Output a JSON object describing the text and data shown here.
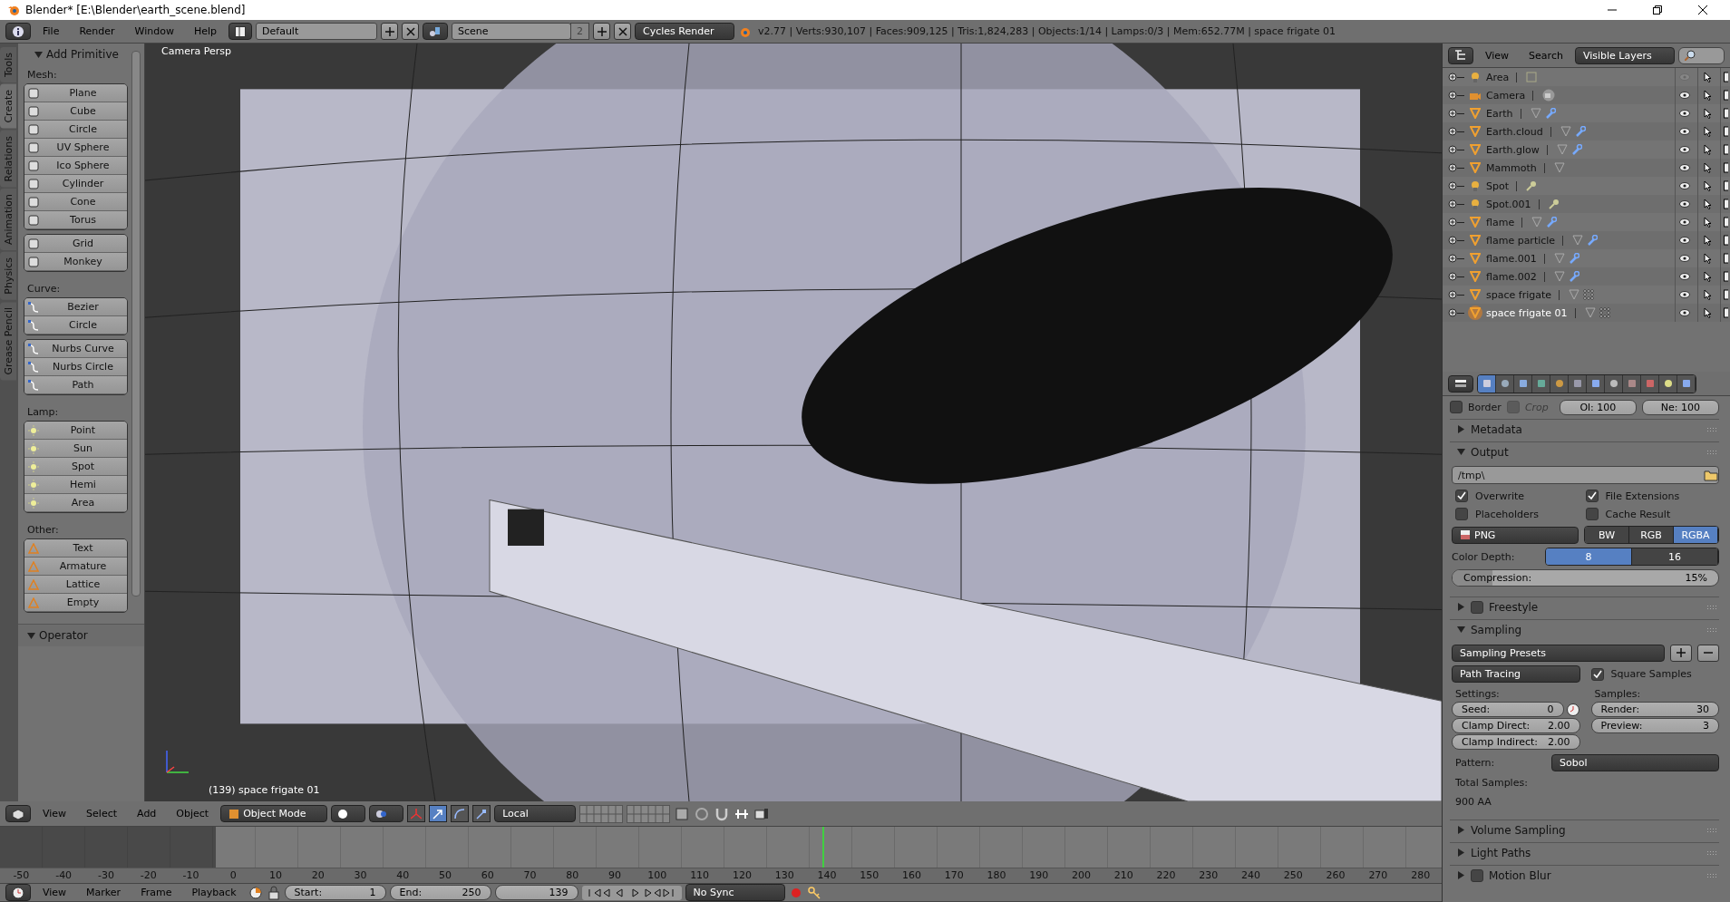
{
  "window": {
    "title": "Blender* [E:\\Blender\\earth_scene.blend]"
  },
  "top_header": {
    "menus": [
      "File",
      "Render",
      "Window",
      "Help"
    ],
    "layout": "Default",
    "scene": "Scene",
    "scene_users": "2",
    "engine": "Cycles Render",
    "stats": "v2.77 | Verts:930,107 | Faces:909,125 | Tris:1,824,283 | Objects:1/14 | Lamps:0/3 | Mem:652.77M | space frigate 01"
  },
  "tool_tabs": [
    {
      "label": "Tools",
      "selected": false
    },
    {
      "label": "Create",
      "selected": true
    },
    {
      "label": "Relations",
      "selected": false
    },
    {
      "label": "Animation",
      "selected": false
    },
    {
      "label": "Physics",
      "selected": false
    },
    {
      "label": "Grease Pencil",
      "selected": false
    }
  ],
  "add_primitive": {
    "title": "Add Primitive",
    "expanded": true,
    "groups": [
      {
        "label": "Mesh:",
        "kind": "mesh",
        "blocks": [
          [
            "Plane",
            "Cube",
            "Circle",
            "UV Sphere",
            "Ico Sphere",
            "Cylinder",
            "Cone",
            "Torus"
          ],
          [
            "Grid",
            "Monkey"
          ]
        ]
      },
      {
        "label": "Curve:",
        "kind": "curve",
        "blocks": [
          [
            "Bezier",
            "Circle"
          ],
          [
            "Nurbs Curve",
            "Nurbs Circle",
            "Path"
          ]
        ]
      },
      {
        "label": "Lamp:",
        "kind": "lamp",
        "blocks": [
          [
            "Point",
            "Sun",
            "Spot",
            "Hemi",
            "Area"
          ]
        ]
      },
      {
        "label": "Other:",
        "kind": "other",
        "blocks": [
          [
            "Text",
            "Armature",
            "Lattice",
            "Empty"
          ]
        ]
      }
    ]
  },
  "operator_panel": {
    "title": "Operator",
    "expanded": true
  },
  "viewport": {
    "view_name": "Camera Persp",
    "object_label": "(139) space frigate 01"
  },
  "view3d_header": {
    "menus": [
      "View",
      "Select",
      "Add",
      "Object"
    ],
    "mode": "Object Mode",
    "orientation": "Local",
    "manipulators": [
      {
        "selected": false
      },
      {
        "selected": true
      },
      {
        "selected": false
      },
      {
        "selected": false
      }
    ]
  },
  "timeline": {
    "ticks": [
      "-50",
      "-40",
      "-30",
      "-20",
      "-10",
      "0",
      "10",
      "20",
      "30",
      "40",
      "50",
      "60",
      "70",
      "80",
      "90",
      "100",
      "110",
      "120",
      "130",
      "140",
      "150",
      "160",
      "170",
      "180",
      "190",
      "200",
      "210",
      "220",
      "230",
      "240",
      "250",
      "260",
      "270",
      "280"
    ],
    "menus": [
      "View",
      "Marker",
      "Frame",
      "Playback"
    ],
    "start_label": "Start:",
    "start": "1",
    "end_label": "End:",
    "end": "250",
    "current_frame": "139",
    "sync": "No Sync"
  },
  "outliner": {
    "menus": [
      "View",
      "Search"
    ],
    "filter": "Visible Layers",
    "items": [
      {
        "name": "Area",
        "kind": "arealamp",
        "selected": false,
        "visible": false
      },
      {
        "name": "Camera",
        "kind": "camera",
        "selected": false,
        "visible": true
      },
      {
        "name": "Earth",
        "kind": "modifiedmesh",
        "selected": false,
        "visible": true
      },
      {
        "name": "Earth.cloud",
        "kind": "modifiedmesh",
        "selected": false,
        "visible": true
      },
      {
        "name": "Earth.glow",
        "kind": "modifiedmesh",
        "selected": false,
        "visible": true
      },
      {
        "name": "Mammoth",
        "kind": "mesh",
        "selected": false,
        "visible": true
      },
      {
        "name": "Spot",
        "kind": "spotlamp",
        "selected": false,
        "visible": true
      },
      {
        "name": "Spot.001",
        "kind": "spotlamp",
        "selected": false,
        "visible": true
      },
      {
        "name": "flame",
        "kind": "modifiedmesh",
        "selected": false,
        "visible": true
      },
      {
        "name": "flame particle",
        "kind": "modifiedmesh",
        "selected": false,
        "visible": true
      },
      {
        "name": "flame.001",
        "kind": "modifiedmesh",
        "selected": false,
        "visible": true
      },
      {
        "name": "flame.002",
        "kind": "modifiedmesh",
        "selected": false,
        "visible": true
      },
      {
        "name": "space frigate",
        "kind": "latticemesh",
        "selected": false,
        "visible": true
      },
      {
        "name": "space frigate 01",
        "kind": "latticemesh",
        "selected": true,
        "visible": true
      }
    ]
  },
  "properties": {
    "tabs": [
      {
        "selected": true
      },
      {
        "selected": false
      },
      {
        "selected": false
      },
      {
        "selected": false
      },
      {
        "selected": false
      },
      {
        "selected": false
      },
      {
        "selected": false
      },
      {
        "selected": false
      },
      {
        "selected": false
      },
      {
        "selected": false
      },
      {
        "selected": false
      },
      {
        "selected": false
      }
    ],
    "border": {
      "label": "Border",
      "checked": false
    },
    "crop": {
      "label": "Crop",
      "checked": false,
      "disabled": true
    },
    "ol": "Ol: 100",
    "ne": "Ne: 100",
    "metadata": {
      "title": "Metadata",
      "expanded": false
    },
    "output": {
      "title": "Output",
      "expanded": true,
      "path": "/tmp\\",
      "checks": [
        {
          "label": "Overwrite",
          "checked": true
        },
        {
          "label": "File Extensions",
          "checked": true
        },
        {
          "label": "Placeholders",
          "checked": false
        },
        {
          "label": "Cache Result",
          "checked": false
        }
      ],
      "format": "PNG",
      "color_modes": [
        {
          "label": "BW",
          "selected": false
        },
        {
          "label": "RGB",
          "selected": false
        },
        {
          "label": "RGBA",
          "selected": true
        }
      ],
      "depth_label": "Color Depth:",
      "depths": [
        {
          "label": "8",
          "selected": true
        },
        {
          "label": "16",
          "selected": false
        }
      ],
      "compression_label": "Compression:",
      "compression": "15%",
      "level": 0.15
    },
    "freestyle": {
      "title": "Freestyle",
      "expanded": false,
      "checked": false
    },
    "sampling": {
      "title": "Sampling",
      "expanded": true,
      "presets": "Sampling Presets",
      "integrator": "Path Tracing",
      "square_samples": {
        "label": "Square Samples",
        "checked": true
      },
      "settings_label": "Settings:",
      "settings": [
        {
          "label": "Seed:",
          "value": "0"
        },
        {
          "label": "Clamp Direct:",
          "value": "2.00"
        },
        {
          "label": "Clamp Indirect:",
          "value": "2.00"
        }
      ],
      "samples_label": "Samples:",
      "samples": [
        {
          "label": "Render:",
          "value": "30"
        },
        {
          "label": "Preview:",
          "value": "3"
        }
      ],
      "pattern_label": "Pattern:",
      "pattern": "Sobol",
      "total_label": "Total Samples:",
      "total": "900 AA"
    },
    "volume_sampling": {
      "title": "Volume Sampling",
      "expanded": false
    },
    "light_paths": {
      "title": "Light Paths",
      "expanded": false
    },
    "motion_blur": {
      "title": "Motion Blur",
      "expanded": false,
      "checked": false
    }
  }
}
